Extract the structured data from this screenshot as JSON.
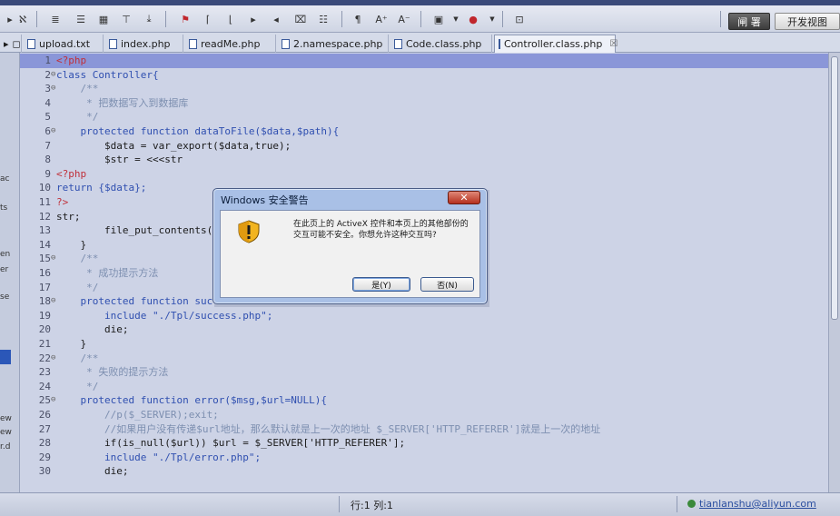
{
  "toolbar": {
    "right_button_dark": "闸 署",
    "right_button_light": "开发视图"
  },
  "tabs": [
    {
      "label": "upload.txt",
      "active": false
    },
    {
      "label": "index.php",
      "active": false
    },
    {
      "label": "readMe.php",
      "active": false
    },
    {
      "label": "2.namespace.php",
      "active": false
    },
    {
      "label": "Code.class.php",
      "active": false
    },
    {
      "label": "Controller.class.php",
      "active": true,
      "close": "☒"
    }
  ],
  "left_panel_labels": [
    "ac",
    "ts",
    "en",
    "er",
    "se",
    "ew",
    "ew",
    "r.d"
  ],
  "code_lines": [
    {
      "n": "1",
      "fold": "",
      "text": "<?php",
      "current": true
    },
    {
      "n": "2",
      "fold": "⊖",
      "text": "class Controller{"
    },
    {
      "n": "3",
      "fold": "⊖",
      "text": "    /**"
    },
    {
      "n": "4",
      "fold": "",
      "text": "     * 把数据写入到数据库"
    },
    {
      "n": "5",
      "fold": "",
      "text": "     */"
    },
    {
      "n": "6",
      "fold": "⊖",
      "text": "    protected function dataToFile($data,$path){"
    },
    {
      "n": "7",
      "fold": "",
      "text": "        $data = var_export($data,true);"
    },
    {
      "n": "8",
      "fold": "",
      "text": "        $str = <<<str"
    },
    {
      "n": "9",
      "fold": "",
      "text": "<?php"
    },
    {
      "n": "10",
      "fold": "",
      "text": "return {$data};"
    },
    {
      "n": "11",
      "fold": "",
      "text": "?>"
    },
    {
      "n": "12",
      "fold": "",
      "text": "str;"
    },
    {
      "n": "13",
      "fold": "",
      "text": "        file_put_contents($"
    },
    {
      "n": "14",
      "fold": "",
      "text": "    }"
    },
    {
      "n": "15",
      "fold": "⊖",
      "text": "    /**"
    },
    {
      "n": "16",
      "fold": "",
      "text": "     * 成功提示方法"
    },
    {
      "n": "17",
      "fold": "",
      "text": "     */"
    },
    {
      "n": "18",
      "fold": "⊖",
      "text": "    protected function suc"
    },
    {
      "n": "19",
      "fold": "",
      "text": "        include \"./Tpl/success.php\";"
    },
    {
      "n": "20",
      "fold": "",
      "text": "        die;"
    },
    {
      "n": "21",
      "fold": "",
      "text": "    }"
    },
    {
      "n": "22",
      "fold": "⊖",
      "text": "    /**"
    },
    {
      "n": "23",
      "fold": "",
      "text": "     * 失败的提示方法"
    },
    {
      "n": "24",
      "fold": "",
      "text": "     */"
    },
    {
      "n": "25",
      "fold": "⊖",
      "text": "    protected function error($msg,$url=NULL){"
    },
    {
      "n": "26",
      "fold": "",
      "text": "        //p($_SERVER);exit;"
    },
    {
      "n": "27",
      "fold": "",
      "text": "        //如果用户没有传递$url地址，那么默认就是上一次的地址 $_SERVER['HTTP_REFERER']就是上一次的地址"
    },
    {
      "n": "28",
      "fold": "",
      "text": "        if(is_null($url)) $url = $_SERVER['HTTP_REFERER'];"
    },
    {
      "n": "29",
      "fold": "",
      "text": "        include \"./Tpl/error.php\";"
    },
    {
      "n": "30",
      "fold": "",
      "text": "        die;"
    }
  ],
  "dialog": {
    "title": "Windows 安全警告",
    "close": "✕",
    "message": "在此页上的 ActiveX 控件和本页上的其他部份的交互可能不安全。你想允许这种交互吗?",
    "yes_label": "是(Y)",
    "no_label": "否(N)"
  },
  "status": {
    "position": "行:1 列:1",
    "user": "tianlanshu@aliyun.com"
  }
}
